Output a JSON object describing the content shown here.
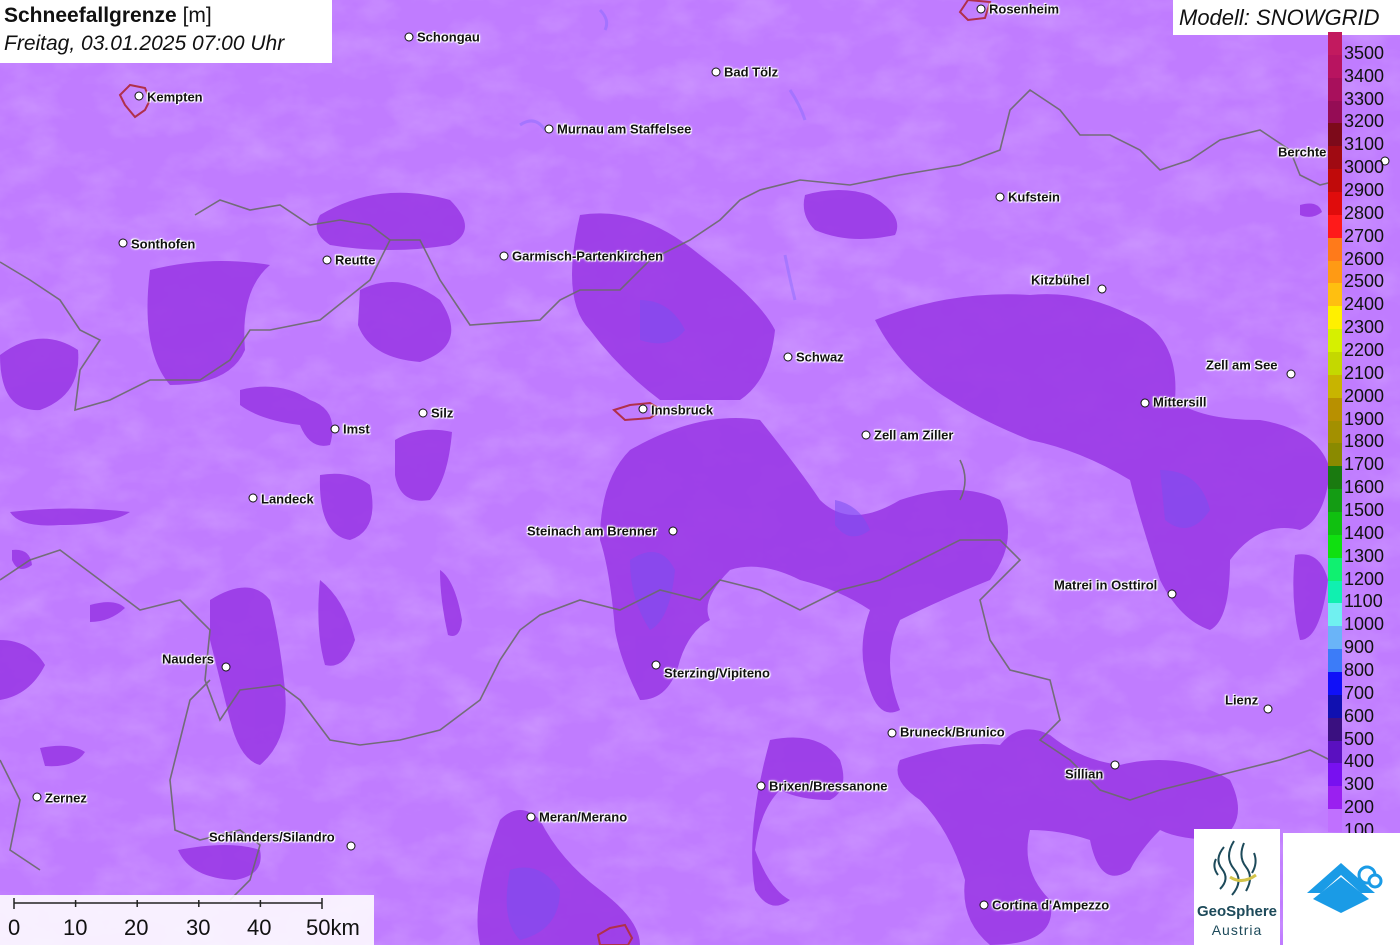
{
  "title": {
    "bold": "Schneefallgrenze",
    "unit": " [m]",
    "subtitle": "Freitag, 03.01.2025 07:00 Uhr"
  },
  "model_label": "Modell: SNOWGRID",
  "cities": [
    {
      "name": "Schongau"
    },
    {
      "name": "Rosenheim"
    },
    {
      "name": "Kempten"
    },
    {
      "name": "Bad Tölz"
    },
    {
      "name": "Murnau am Staffelsee"
    },
    {
      "name": "Berchte"
    },
    {
      "name": "Kufstein"
    },
    {
      "name": "Sonthofen"
    },
    {
      "name": "Reutte"
    },
    {
      "name": "Garmisch-Partenkirchen"
    },
    {
      "name": "Kitzbühel"
    },
    {
      "name": "Schwaz"
    },
    {
      "name": "Zell am See"
    },
    {
      "name": "Mittersill"
    },
    {
      "name": "Innsbruck"
    },
    {
      "name": "Silz"
    },
    {
      "name": "Imst"
    },
    {
      "name": "Zell am Ziller"
    },
    {
      "name": "Landeck"
    },
    {
      "name": "Steinach am Brenner"
    },
    {
      "name": "Matrei in Osttirol"
    },
    {
      "name": "Nauders"
    },
    {
      "name": "Sterzing/Vipiteno"
    },
    {
      "name": "Lienz"
    },
    {
      "name": "Bruneck/Brunico"
    },
    {
      "name": "Sillian"
    },
    {
      "name": "Brixen/Bressanone"
    },
    {
      "name": "Zernez"
    },
    {
      "name": "Meran/Merano"
    },
    {
      "name": "Schlanders/Silandro"
    },
    {
      "name": "Cortina d'Ampezzo"
    }
  ],
  "legend": [
    {
      "label": "3500",
      "color": "#c21a5f"
    },
    {
      "label": "3400",
      "color": "#b81460"
    },
    {
      "label": "3300",
      "color": "#a8105c"
    },
    {
      "label": "3200",
      "color": "#950c55"
    },
    {
      "label": "3100",
      "color": "#7d0a1a"
    },
    {
      "label": "3000",
      "color": "#a00a12"
    },
    {
      "label": "2900",
      "color": "#c00a0a"
    },
    {
      "label": "2800",
      "color": "#e00c0c"
    },
    {
      "label": "2700",
      "color": "#ff1a1a"
    },
    {
      "label": "2600",
      "color": "#ff7a1a"
    },
    {
      "label": "2500",
      "color": "#ff9a14"
    },
    {
      "label": "2400",
      "color": "#ffbf10"
    },
    {
      "label": "2300",
      "color": "#fff000"
    },
    {
      "label": "2200",
      "color": "#d6f000"
    },
    {
      "label": "2100",
      "color": "#c4d800"
    },
    {
      "label": "2000",
      "color": "#c8b400"
    },
    {
      "label": "1900",
      "color": "#b89000"
    },
    {
      "label": "1800",
      "color": "#a39000"
    },
    {
      "label": "1700",
      "color": "#8a8a00"
    },
    {
      "label": "1600",
      "color": "#1a7a10"
    },
    {
      "label": "1500",
      "color": "#149c14"
    },
    {
      "label": "1400",
      "color": "#10c010"
    },
    {
      "label": "1300",
      "color": "#10e010"
    },
    {
      "label": "1200",
      "color": "#10f070"
    },
    {
      "label": "1100",
      "color": "#10f0b0"
    },
    {
      "label": "1000",
      "color": "#70f0f0"
    },
    {
      "label": "900",
      "color": "#6ab4f8"
    },
    {
      "label": "800",
      "color": "#3c7cf8"
    },
    {
      "label": "700",
      "color": "#1010f8"
    },
    {
      "label": "600",
      "color": "#1010b0"
    },
    {
      "label": "500",
      "color": "#3a1080"
    },
    {
      "label": "400",
      "color": "#5a10c0"
    },
    {
      "label": "300",
      "color": "#7810f0"
    },
    {
      "label": "200",
      "color": "#9a20f0"
    },
    {
      "label": "100",
      "color": "#c070ff"
    }
  ],
  "scale_labels": [
    "0",
    "10",
    "20",
    "30",
    "40",
    "50km"
  ],
  "logos": {
    "geosphere_line1": "GeoSphere",
    "geosphere_line2": "Austria"
  },
  "colors": {
    "background": "#c07cff",
    "darker_zone": "#9a3ae6",
    "darkest_zone": "#8a40e8",
    "border": "#6e6e6e"
  }
}
